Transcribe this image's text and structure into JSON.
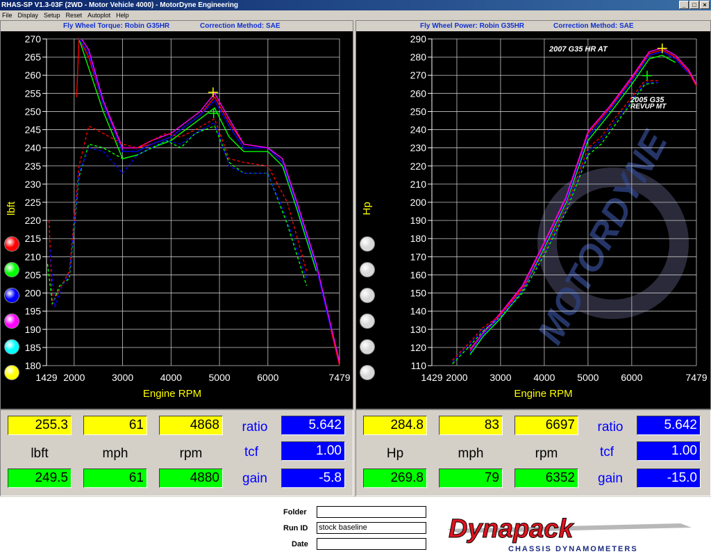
{
  "window": {
    "title": "RHAS-SP V1.3-03F  (2WD - Motor Vehicle 4000) - MotorDyne Engineering"
  },
  "menu": [
    "File",
    "Display",
    "Setup",
    "Reset",
    "Autoplot",
    "Help"
  ],
  "left_chart": {
    "header_title": "Fly Wheel Torque: Robin G35HR",
    "header_correction": "Correction Method: SAE",
    "ylabel": "lbft",
    "xlabel": "Engine RPM",
    "y_ticks": [
      "270",
      "265",
      "260",
      "255",
      "250",
      "245",
      "240",
      "235",
      "230",
      "225",
      "220",
      "215",
      "210",
      "205",
      "200",
      "195",
      "190",
      "185",
      "180"
    ],
    "x_ticks": [
      "1429",
      "2000",
      "3000",
      "4000",
      "5000",
      "6000",
      "7479"
    ]
  },
  "right_chart": {
    "header_title": "Fly Wheel Power: Robin G35HR",
    "header_correction": "Correction Method: SAE",
    "ylabel": "Hp",
    "xlabel": "Engine RPM",
    "y_ticks": [
      "290",
      "280",
      "270",
      "260",
      "250",
      "240",
      "230",
      "220",
      "210",
      "200",
      "190",
      "180",
      "170",
      "160",
      "150",
      "140",
      "130",
      "120",
      "110"
    ],
    "x_ticks": [
      "1429",
      "2000",
      "3000",
      "4000",
      "5000",
      "6000",
      "7479"
    ],
    "annotation_top": "2007 G35 HR AT",
    "annotation_low_1": "2005 G35",
    "annotation_low_2": "REVUP MT",
    "watermark": "MOTORDYNE"
  },
  "chart_data": [
    {
      "type": "line",
      "title": "Fly Wheel Torque: Robin G35HR",
      "xlabel": "Engine RPM",
      "ylabel": "lbft",
      "xlim": [
        1429,
        7479
      ],
      "ylim": [
        180,
        270
      ],
      "grid": true,
      "series": [
        {
          "color": "#ff0000",
          "style": "solid",
          "x": [
            2050,
            2100,
            2300,
            2600,
            3000,
            3300,
            3600,
            4000,
            4300,
            4600,
            4900,
            5200,
            5500,
            6000,
            6300,
            6600,
            7000,
            7300,
            7479
          ],
          "values": [
            254,
            270,
            265,
            252,
            240,
            240,
            241,
            243,
            246,
            249,
            254,
            247,
            241,
            240,
            236,
            225,
            207,
            190,
            180
          ]
        },
        {
          "color": "#00ff00",
          "style": "solid",
          "x": [
            2100,
            2300,
            2600,
            3000,
            3300,
            3600,
            4000,
            4300,
            4600,
            4900,
            5200,
            5500,
            6000,
            6300,
            6600,
            7000
          ],
          "values": [
            270,
            262,
            250,
            237,
            238,
            240,
            242,
            245,
            248,
            251,
            243,
            239,
            239,
            235,
            223,
            206
          ]
        },
        {
          "color": "#0000ff",
          "style": "solid",
          "x": [
            2100,
            2300,
            2600,
            3000,
            3300,
            3600,
            4000,
            4300,
            4600,
            4900,
            5200,
            5500,
            6000,
            6300,
            6600,
            7000,
            7300
          ],
          "values": [
            270,
            266,
            252,
            239,
            239,
            241,
            243,
            246,
            249,
            253,
            246,
            240,
            240,
            236,
            224,
            207,
            190
          ]
        },
        {
          "color": "#ff00ff",
          "style": "solid",
          "x": [
            2150,
            2300,
            2600,
            3000,
            3300,
            3600,
            4000,
            4300,
            4600,
            4900,
            5200,
            5500,
            6000,
            6300,
            6600,
            7000,
            7300,
            7479
          ],
          "values": [
            270,
            267,
            253,
            240,
            240,
            242,
            244,
            247,
            250,
            255,
            248,
            241,
            240,
            237,
            225,
            208,
            191,
            181
          ]
        },
        {
          "color": "#ff0000",
          "style": "dashed",
          "x": [
            1480,
            1550,
            1700,
            1900,
            2100,
            2300,
            2600,
            3000,
            3300,
            3600,
            3900,
            4200,
            4500,
            4900,
            5200,
            5500,
            6000,
            6400,
            6800
          ],
          "values": [
            220,
            197,
            201,
            206,
            235,
            246,
            244,
            241,
            240,
            242,
            244,
            243,
            245,
            248,
            237,
            236,
            235,
            225,
            206
          ]
        },
        {
          "color": "#00ff00",
          "style": "dashed",
          "x": [
            1450,
            1550,
            1700,
            1900,
            2100,
            2300,
            2600,
            3000,
            3300,
            3600,
            3900,
            4200,
            4500,
            4900,
            5200,
            5500,
            6000,
            6400,
            6800
          ],
          "values": [
            208,
            197,
            202,
            204,
            232,
            241,
            240,
            237,
            238,
            240,
            242,
            240,
            244,
            246,
            236,
            233,
            233,
            219,
            202
          ]
        },
        {
          "color": "#0000ff",
          "style": "dashed",
          "x": [
            1500,
            1600,
            1750,
            1900,
            2100,
            2300,
            2600,
            3000,
            3300,
            3600,
            3900,
            4200,
            4500,
            4900,
            5200,
            5500,
            6000,
            6400,
            6800
          ],
          "values": [
            212,
            196,
            202,
            205,
            233,
            240,
            239,
            233,
            238,
            240,
            242,
            241,
            244,
            247,
            235,
            233,
            233,
            220,
            204
          ]
        }
      ]
    },
    {
      "type": "line",
      "title": "Fly Wheel Power: Robin G35HR",
      "xlabel": "Engine RPM",
      "ylabel": "Hp",
      "xlim": [
        1429,
        7479
      ],
      "ylim": [
        110,
        290
      ],
      "grid": true,
      "series": [
        {
          "color": "#ff0000",
          "style": "solid",
          "x": [
            2300,
            2600,
            3000,
            3500,
            4000,
            4500,
            5000,
            5500,
            6000,
            6400,
            6700,
            7000,
            7300,
            7479
          ],
          "values": [
            118,
            127,
            138,
            153,
            177,
            202,
            238,
            252,
            268,
            282,
            284,
            280,
            272,
            264
          ]
        },
        {
          "color": "#00ff00",
          "style": "solid",
          "x": [
            2300,
            2600,
            3000,
            3500,
            4000,
            4500,
            5000,
            5500,
            6000,
            6400,
            6700,
            7000
          ],
          "values": [
            116,
            126,
            136,
            151,
            175,
            200,
            234,
            249,
            265,
            279,
            281,
            277
          ]
        },
        {
          "color": "#0000ff",
          "style": "solid",
          "x": [
            2300,
            2600,
            3000,
            3500,
            4000,
            4500,
            5000,
            5500,
            6000,
            6400,
            6700,
            7000,
            7300
          ],
          "values": [
            117,
            127,
            137,
            152,
            176,
            201,
            236,
            251,
            267,
            281,
            283,
            279,
            271
          ]
        },
        {
          "color": "#ff00ff",
          "style": "solid",
          "x": [
            2300,
            2600,
            3000,
            3500,
            4000,
            4500,
            5000,
            5500,
            6000,
            6400,
            6700,
            7000,
            7300,
            7479
          ],
          "values": [
            119,
            128,
            139,
            154,
            178,
            203,
            239,
            253,
            269,
            283,
            285,
            281,
            273,
            265
          ]
        },
        {
          "color": "#ff0000",
          "style": "dashed",
          "x": [
            1900,
            2100,
            2300,
            2600,
            3000,
            3500,
            4000,
            4500,
            5000,
            5300,
            5600,
            6000,
            6300,
            6600
          ],
          "values": [
            113,
            118,
            123,
            131,
            138,
            152,
            173,
            197,
            230,
            236,
            246,
            258,
            267,
            267
          ]
        },
        {
          "color": "#00ff00",
          "style": "dashed",
          "x": [
            1900,
            2100,
            2300,
            2600,
            3000,
            3500,
            4000,
            4500,
            5000,
            5300,
            5600,
            6000,
            6300,
            6600
          ],
          "values": [
            111,
            116,
            121,
            129,
            137,
            150,
            171,
            195,
            226,
            232,
            242,
            255,
            265,
            266
          ]
        },
        {
          "color": "#0000ff",
          "style": "dashed",
          "x": [
            1900,
            2100,
            2300,
            2600,
            3000,
            3500,
            4000,
            4500,
            5000,
            5300,
            5600,
            6000,
            6300,
            6600
          ],
          "values": [
            112,
            117,
            122,
            130,
            137,
            151,
            172,
            196,
            228,
            234,
            244,
            256,
            266,
            266
          ]
        }
      ]
    }
  ],
  "left_dots": [
    "#ff0000",
    "#00ff00",
    "#0000ff",
    "#ff00ff",
    "#00ffff",
    "#ffff00"
  ],
  "right_dots": [
    "#d8d8d8",
    "#d8d8d8",
    "#d8d8d8",
    "#d8d8d8",
    "#d8d8d8",
    "#d8d8d8"
  ],
  "left_readout": {
    "row1": [
      "255.3",
      "61",
      "4868"
    ],
    "labels": [
      "lbft",
      "mph",
      "rpm"
    ],
    "row2": [
      "249.5",
      "61",
      "4880"
    ],
    "ratio_label": "ratio",
    "ratio": "5.642",
    "tcf_label": "tcf",
    "tcf": "1.00",
    "gain_label": "gain",
    "gain": "-5.8"
  },
  "right_readout": {
    "row1": [
      "284.8",
      "83",
      "6697"
    ],
    "labels": [
      "Hp",
      "mph",
      "rpm"
    ],
    "row2": [
      "269.8",
      "79",
      "6352"
    ],
    "ratio_label": "ratio",
    "ratio": "5.642",
    "tcf_label": "tcf",
    "tcf": "1.00",
    "gain_label": "gain",
    "gain": "-15.0"
  },
  "footer": {
    "folder_label": "Folder",
    "folder_value": "",
    "runid_label": "Run ID",
    "runid_value": "stock baseline",
    "date_label": "Date",
    "date_value": "",
    "logo_text": "Dynapack",
    "logo_subtext": "CHASSIS DYNAMOMETERS"
  }
}
